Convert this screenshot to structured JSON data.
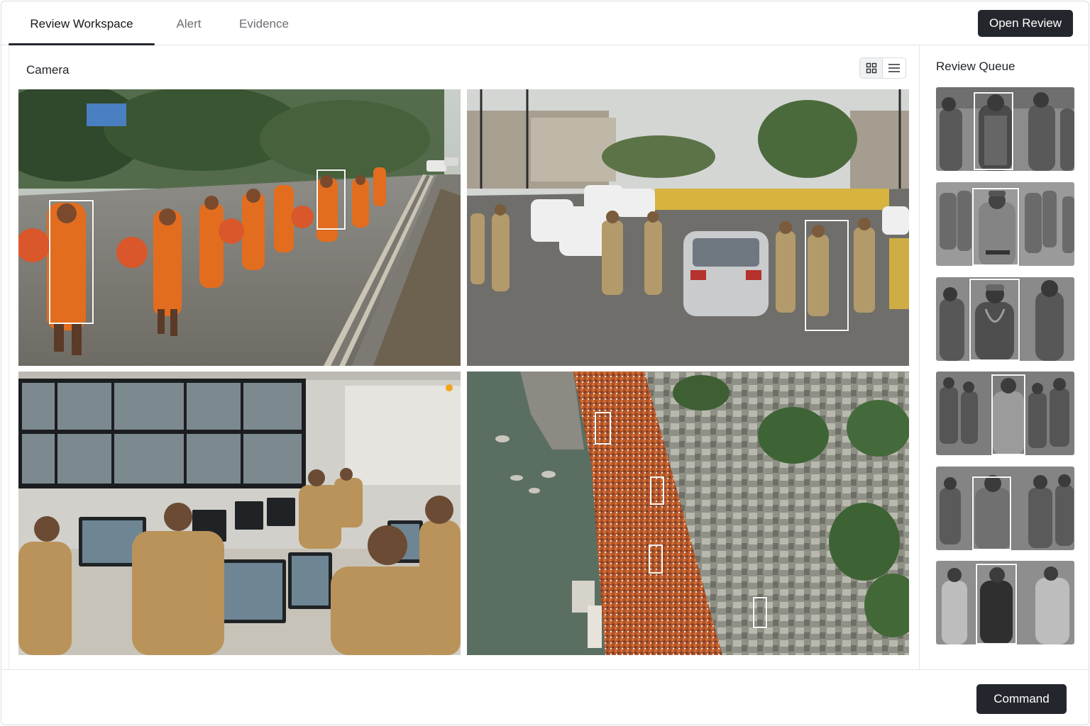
{
  "tabs": [
    {
      "label": "Review Workspace",
      "active": true
    },
    {
      "label": "Alert",
      "active": false
    },
    {
      "label": "Evidence",
      "active": false
    }
  ],
  "header": {
    "open_review_label": "Open Review"
  },
  "camera": {
    "title": "Camera",
    "view_modes": [
      {
        "icon": "grid-view-icon",
        "active": true
      },
      {
        "icon": "list-view-icon",
        "active": false
      }
    ],
    "feeds": [
      {
        "scene": "procession-road",
        "detections": 2
      },
      {
        "scene": "police-checkpoint",
        "detections": 1
      },
      {
        "scene": "control-room",
        "detections": 0
      },
      {
        "scene": "aerial-crowd-riverbank",
        "detections": 4
      }
    ]
  },
  "queue": {
    "title": "Review Queue",
    "items": [
      {
        "subject": "pilgrim"
      },
      {
        "subject": "officer"
      },
      {
        "subject": "pilgrim"
      },
      {
        "subject": "walker"
      },
      {
        "subject": "walker"
      },
      {
        "subject": "walker"
      }
    ]
  },
  "footer": {
    "command_label": "Command"
  },
  "colors": {
    "accent_dark": "#23272d",
    "border": "#e2e5e9",
    "saffron": "#e0671c",
    "khaki": "#b39a6b"
  }
}
